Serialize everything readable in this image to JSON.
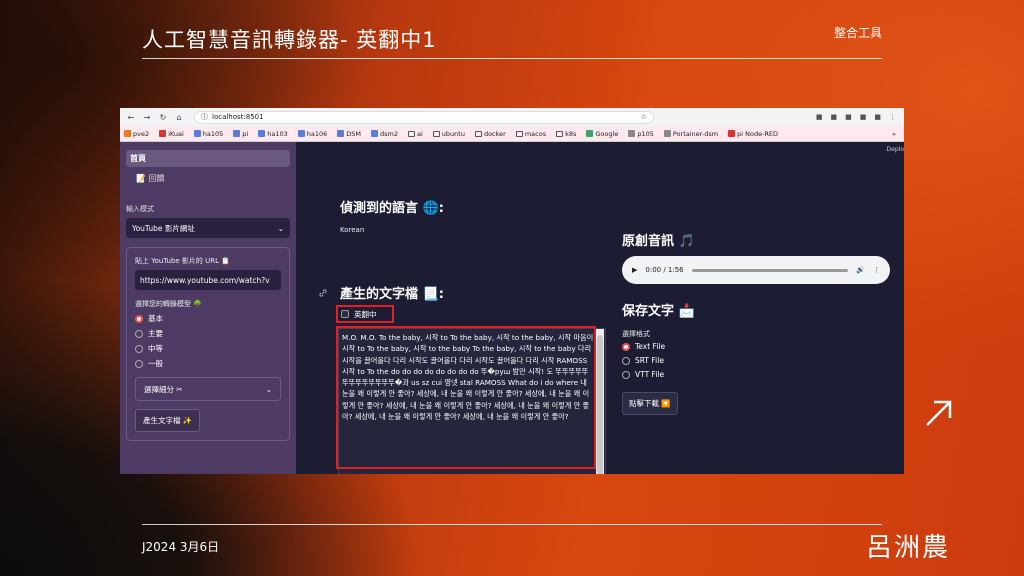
{
  "slide": {
    "title": "人工智慧音訊轉錄器- 英翻中1",
    "tag": "整合工具",
    "date": "J2024 3月6日",
    "author": "呂洲農"
  },
  "browser": {
    "url": "localhost:8501",
    "bookmarks": [
      "pve2",
      "iKuai",
      "ha105",
      "pi",
      "ha103",
      "ha106",
      "DSM",
      "dsm2",
      "ai",
      "ubuntu",
      "docker",
      "macos",
      "k8s",
      "Google",
      "p105",
      "Portainer-dsm",
      "pi Node-RED"
    ],
    "bookmarks_more": "»"
  },
  "sidebar": {
    "nav": [
      {
        "label": "首頁",
        "active": true
      },
      {
        "label": "📝 回饋",
        "active": false
      }
    ],
    "input_mode_label": "輸入模式",
    "input_mode_value": "YouTube 影片網址",
    "url_label": "貼上 YouTube 影片的 URL 📋",
    "url_value": "https://www.youtube.com/watch?v",
    "model_label": "選擇您的轉錄模型 🌳",
    "models": [
      {
        "label": "基本",
        "selected": true
      },
      {
        "label": "主要",
        "selected": false
      },
      {
        "label": "中等",
        "selected": false
      },
      {
        "label": "一般",
        "selected": false
      }
    ],
    "segments_label": "選擇細分 ✂",
    "generate_button": "產生文字檔 ✨"
  },
  "main": {
    "deploy": "Deplo",
    "detected_lang_title": "偵測到的語言 🌐:",
    "detected_lang_value": "Korean",
    "generated_title": "產生的文字檔 📃:",
    "translate_checkbox": "英翻中",
    "transcript": "M.O. M.O. To the baby, 시작 to To the baby, 시작 to the baby, 시작 마음이 시작 to To the baby, 시작 to the baby To the baby, 시작 to the baby 다리 시작을 끌어올다 다리 시작도 끌어올다 다리 시작도 끌어올다 다리 시작 RAMOSS 시작 to To the do do do do do do do do 뚜�pyш 밤만 시작! 도 뚜뚜뚜뚜뚜뚜뚜뚜뚜뚜뚜뚜뚜�과 us sz cui 영넷 stal RAMOSS What do i do where 내 눈을 왜 이렇게 안 좋아? 세상에, 내 눈을 왜 이렇게 안 좋아? 세상에, 내 눈을 왜 이렇게 안 좋아? 세상에, 내 눈을 왜 이렇게 안 좋아? 세상에, 내 눈을 왜 이렇게 안 좋아? 세상에, 내 눈을 왜 이렇게 안 좋아? 세상에, 내 눈을 왜 이렇게 안 좋아?",
    "original_audio_title": "原創音訊 🎵",
    "audio_time": "0:00 / 1:56",
    "save_title": "保存文字 📩",
    "format_label": "選擇格式",
    "formats": [
      {
        "label": "Text File",
        "selected": true
      },
      {
        "label": "SRT File",
        "selected": false
      },
      {
        "label": "VTT File",
        "selected": false
      }
    ],
    "download_button": "點擊下載 🔽"
  }
}
